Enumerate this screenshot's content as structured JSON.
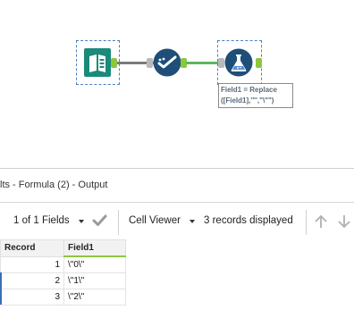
{
  "canvas": {
    "annotation_lines": [
      "Field1 = Replace",
      "([Field1],'\"',\"\\\"\")"
    ]
  },
  "results": {
    "header_title": "lts - Formula (2) - Output",
    "toolbar": {
      "fields_label": "1 of 1 Fields",
      "viewer_label": "Cell Viewer",
      "records_label": "3 records displayed"
    },
    "columns": [
      "Record",
      "Field1"
    ],
    "rows": [
      {
        "record": "1",
        "field1": "\\\"0\\\""
      },
      {
        "record": "2",
        "field1": "\\\"1\\\""
      },
      {
        "record": "3",
        "field1": "\\\"2\\\""
      }
    ]
  },
  "colors": {
    "tool_teal": "#1a8a7a",
    "tool_navy": "#1f4e79",
    "anchor_green": "#8dc63f",
    "selection_blue": "#4a7fc1"
  }
}
